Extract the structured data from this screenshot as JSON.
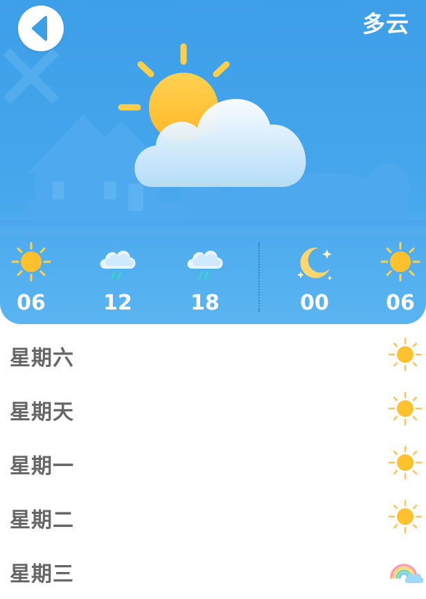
{
  "header": {
    "condition": "多云",
    "back_icon": "back-arrow-icon",
    "main_icon": "partly-cloudy-icon"
  },
  "hourly": [
    {
      "time": "06",
      "icon": "sun-icon"
    },
    {
      "time": "12",
      "icon": "rain-cloud-icon"
    },
    {
      "time": "18",
      "icon": "rain-cloud-icon"
    },
    {
      "time": "00",
      "icon": "moon-icon"
    },
    {
      "time": "06",
      "icon": "sun-icon"
    }
  ],
  "daily": [
    {
      "day": "星期六",
      "icon": "sun-icon"
    },
    {
      "day": "星期天",
      "icon": "sun-icon"
    },
    {
      "day": "星期一",
      "icon": "sun-icon"
    },
    {
      "day": "星期二",
      "icon": "sun-icon"
    },
    {
      "day": "星期三",
      "icon": "rainbow-icon"
    }
  ],
  "colors": {
    "header_blue": "#3D9FE8",
    "sun_yellow": "#FFC83A",
    "text_gray": "#666666"
  }
}
